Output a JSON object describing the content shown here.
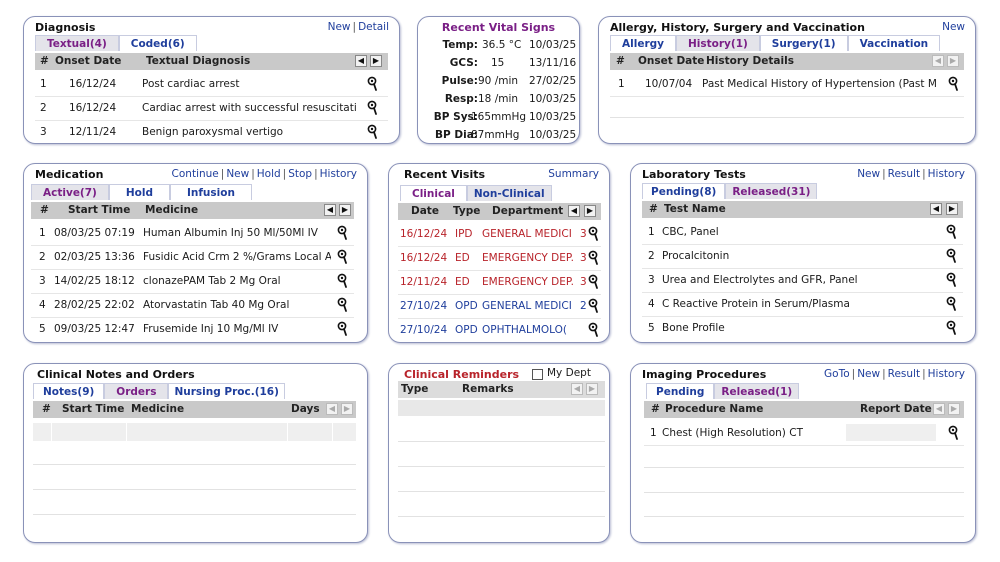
{
  "diagnosis": {
    "title": "Diagnosis",
    "links": [
      "New",
      "Detail"
    ],
    "tabs": [
      "Textual(4)",
      "Coded(6)"
    ],
    "columns": [
      "#",
      "Onset Date",
      "Textual Diagnosis"
    ],
    "rows": [
      {
        "num": "1",
        "date": "16/12/24",
        "text": "Post cardiac arrest"
      },
      {
        "num": "2",
        "date": "16/12/24",
        "text": "Cardiac arrest with successful resuscitation"
      },
      {
        "num": "3",
        "date": "12/11/24",
        "text": "Benign paroxysmal vertigo"
      }
    ]
  },
  "vitals": {
    "title": "Recent Vital Signs",
    "rows": [
      {
        "label": "Temp:",
        "value": "36.5 °C",
        "date": "10/03/25"
      },
      {
        "label": "GCS:",
        "value": "15",
        "date": "13/11/16"
      },
      {
        "label": "Pulse:",
        "value": "90 /min",
        "date": "27/02/25"
      },
      {
        "label": "Resp:",
        "value": "18 /min",
        "date": "10/03/25"
      },
      {
        "label": "BP Sys:",
        "value": "165mmHg",
        "date": "10/03/25"
      },
      {
        "label": "BP Dia:",
        "value": "87mmHg",
        "date": "10/03/25"
      }
    ]
  },
  "allergy": {
    "title": "Allergy, History, Surgery and Vaccination",
    "links": [
      "New"
    ],
    "tabs": [
      "Allergy",
      "History(1)",
      "Surgery(1)",
      "Vaccination"
    ],
    "columns": [
      "#",
      "Onset Date",
      "History Details"
    ],
    "rows": [
      {
        "num": "1",
        "date": "10/07/04",
        "text": "Past Medical History of Hypertension (Past M"
      }
    ]
  },
  "medication": {
    "title": "Medication",
    "links": [
      "Continue",
      "New",
      "Hold",
      "Stop",
      "History"
    ],
    "tabs": [
      "Active(7)",
      "Hold",
      "Infusion"
    ],
    "columns": [
      "#",
      "Start Time",
      "Medicine"
    ],
    "rows": [
      {
        "num": "1",
        "time": "08/03/25 07:19",
        "medicine": "Human Albumin Inj 50 Ml/50Ml IV"
      },
      {
        "num": "2",
        "time": "02/03/25 13:36",
        "medicine": "Fusidic Acid Crm 2 %/Grams Local A"
      },
      {
        "num": "3",
        "time": "14/02/25 18:12",
        "medicine": "clonazePAM Tab 2 Mg Oral"
      },
      {
        "num": "4",
        "time": "28/02/25 22:02",
        "medicine": "Atorvastatin Tab 40 Mg Oral"
      },
      {
        "num": "5",
        "time": "09/03/25 12:47",
        "medicine": "Frusemide Inj 10 Mg/Ml IV"
      }
    ]
  },
  "visits": {
    "title": "Recent Visits",
    "links": [
      "Summary"
    ],
    "tabs": [
      "Clinical",
      "Non-Clinical"
    ],
    "columns": [
      "Date",
      "Type",
      "Department"
    ],
    "rows": [
      {
        "date": "16/12/24",
        "type": "IPD",
        "dept": "GENERAL MEDICI",
        "extra": "3",
        "color": "#b8232a"
      },
      {
        "date": "16/12/24",
        "type": "ED",
        "dept": "EMERGENCY DEP.",
        "extra": "3",
        "color": "#b8232a"
      },
      {
        "date": "12/11/24",
        "type": "ED",
        "dept": "EMERGENCY DEP.",
        "extra": "3",
        "color": "#b8232a"
      },
      {
        "date": "27/10/24",
        "type": "OPD",
        "dept": "GENERAL MEDICI",
        "extra": "2",
        "color": "#1f3e9c"
      },
      {
        "date": "27/10/24",
        "type": "OPD",
        "dept": "OPHTHALMOLO(",
        "extra": "",
        "color": "#1f3e9c"
      }
    ]
  },
  "lab": {
    "title": "Laboratory Tests",
    "links": [
      "New",
      "Result",
      "History"
    ],
    "tabs": [
      "Pending(8)",
      "Released(31)"
    ],
    "columns": [
      "#",
      "Test Name"
    ],
    "rows": [
      {
        "num": "1",
        "name": "CBC, Panel"
      },
      {
        "num": "2",
        "name": "Procalcitonin"
      },
      {
        "num": "3",
        "name": "Urea and Electrolytes and GFR, Panel"
      },
      {
        "num": "4",
        "name": "C Reactive Protein in Serum/Plasma"
      },
      {
        "num": "5",
        "name": "Bone Profile"
      }
    ]
  },
  "notes": {
    "title": "Clinical Notes and Orders",
    "tabs": [
      "Notes(9)",
      "Orders",
      "Nursing Proc.(16)"
    ],
    "columns": [
      "#",
      "Start Time",
      "Medicine",
      "Days"
    ]
  },
  "reminders": {
    "title": "Clinical Reminders",
    "checkbox_label": "My Dept",
    "columns": [
      "Type",
      "Remarks"
    ]
  },
  "imaging": {
    "title": "Imaging Procedures",
    "links": [
      "GoTo",
      "New",
      "Result",
      "History"
    ],
    "tabs": [
      "Pending",
      "Released(1)"
    ],
    "columns": [
      "#",
      "Procedure Name",
      "Report Date"
    ],
    "rows": [
      {
        "num": "1",
        "name": "Chest (High Resolution) CT"
      }
    ]
  },
  "icons": {
    "row_action": "pin-icon",
    "scroll_left": "arrow-left-icon",
    "scroll_right": "arrow-right-icon"
  },
  "colors": {
    "link": "#1f3e9c",
    "tab_purple": "#7a1f86",
    "alert_red": "#b8232a",
    "header_gray": "#c9c9c9",
    "border": "#8a92b8"
  }
}
